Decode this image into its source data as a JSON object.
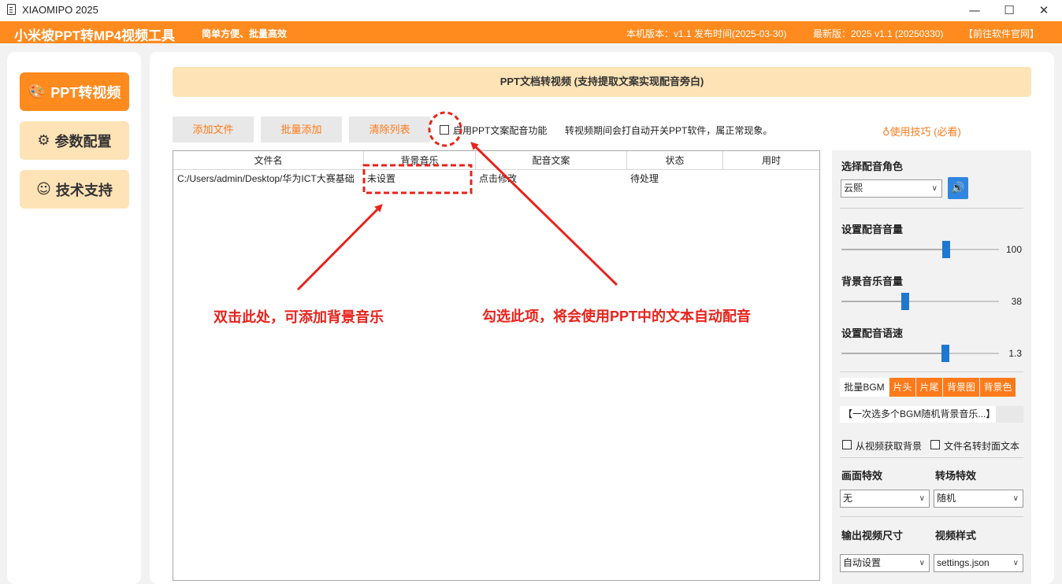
{
  "window": {
    "title": "XIAOMIPO 2025",
    "minimize": "—",
    "maximize": "☐",
    "close": "✕"
  },
  "header": {
    "app_title": "小米坡PPT转MP4视频工具",
    "slogan": "简单方便、批量高效",
    "version": "本机版本：v1.1  发布时间(2025-03-30)",
    "latest": "最新版：2025 v1.1 (20250330)",
    "site_link": "【前往软件官网】"
  },
  "sidebar": {
    "items": [
      {
        "label": "PPT转视频",
        "icon": "palette-icon",
        "active": true
      },
      {
        "label": "参数配置",
        "icon": "gear-icon",
        "active": false
      },
      {
        "label": "技术支持",
        "icon": "user-support-icon",
        "active": false
      }
    ]
  },
  "main": {
    "banner": "PPT文档转视频 (支持提取文案实现配音旁白)",
    "toolbar": {
      "add_file": "添加文件",
      "batch_add": "批量添加",
      "clear_list": "清除列表",
      "enable_ppt_voice": "启用PPT文案配音功能",
      "note": "转视频期间会打自动开关PPT软件，属正常现象。",
      "tips": "使用技巧 (必看)"
    },
    "table": {
      "columns": [
        "文件名",
        "背景音乐",
        "配音文案",
        "状态",
        "用时"
      ],
      "rows": [
        [
          "C:/Users/admin/Desktop/华为ICT大赛基础",
          "未设置",
          "点击修改",
          "待处理",
          ""
        ]
      ]
    }
  },
  "settings": {
    "voice_role_label": "选择配音角色",
    "voice_role_value": "云熙",
    "voice_volume_label": "设置配音音量",
    "voice_volume": 100,
    "bgm_volume_label": "背景音乐音量",
    "bgm_volume": 38,
    "voice_speed_label": "设置配音语速",
    "voice_speed": 1.3,
    "tabs": [
      "批量BGM",
      "片头",
      "片尾",
      "背景图",
      "背景色"
    ],
    "bgm_hint": "【一次选多个BGM随机背景音乐...】",
    "from_video_bg": "从视频获取背景",
    "filename_cover": "文件名转封面文本",
    "effect_label": "画面特效",
    "effect_value": "无",
    "transition_label": "转场特效",
    "transition_value": "随机",
    "size_label": "输出视频尺寸",
    "size_value": "自动设置",
    "style_label": "视频样式",
    "style_value": "settings.json"
  },
  "annotations": {
    "left": "双击此处，可添加背景音乐",
    "right": "勾选此项，将会使用PPT中的文本自动配音"
  },
  "colors": {
    "accent": "#ff8a1d",
    "accent_light": "#fde3b6",
    "slider_thumb": "#1e78d2",
    "annotation_red": "#e8231c"
  }
}
